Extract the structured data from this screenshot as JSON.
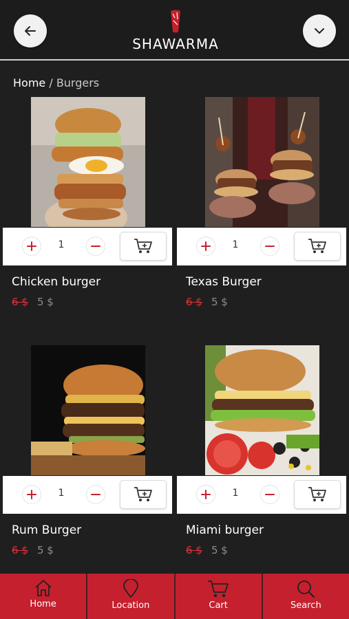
{
  "header": {
    "brand": "SHAWARMA",
    "back_icon": "arrow-left-icon",
    "menu_icon": "chevron-down-icon"
  },
  "breadcrumb": {
    "home": "Home",
    "separator": " / ",
    "current": "Burgers"
  },
  "colors": {
    "accent": "#c4202e",
    "background": "#1f1f1f",
    "old_price": "#d8323b",
    "new_price": "#8d8d8d"
  },
  "products": [
    {
      "name": "Chicken burger",
      "old_price": "6 $",
      "price": "5 $",
      "quantity": "1"
    },
    {
      "name": "Texas Burger",
      "old_price": "6 $",
      "price": "5 $",
      "quantity": "1"
    },
    {
      "name": "Rum Burger",
      "old_price": "6 $",
      "price": "5 $",
      "quantity": "1"
    },
    {
      "name": "Miami burger",
      "old_price": "6 $",
      "price": "5 $",
      "quantity": "1"
    }
  ],
  "bottom_nav": [
    {
      "label": "Home",
      "icon": "home-icon"
    },
    {
      "label": "Location",
      "icon": "location-pin-icon"
    },
    {
      "label": "Cart",
      "icon": "cart-icon"
    },
    {
      "label": "Search",
      "icon": "search-icon"
    }
  ]
}
